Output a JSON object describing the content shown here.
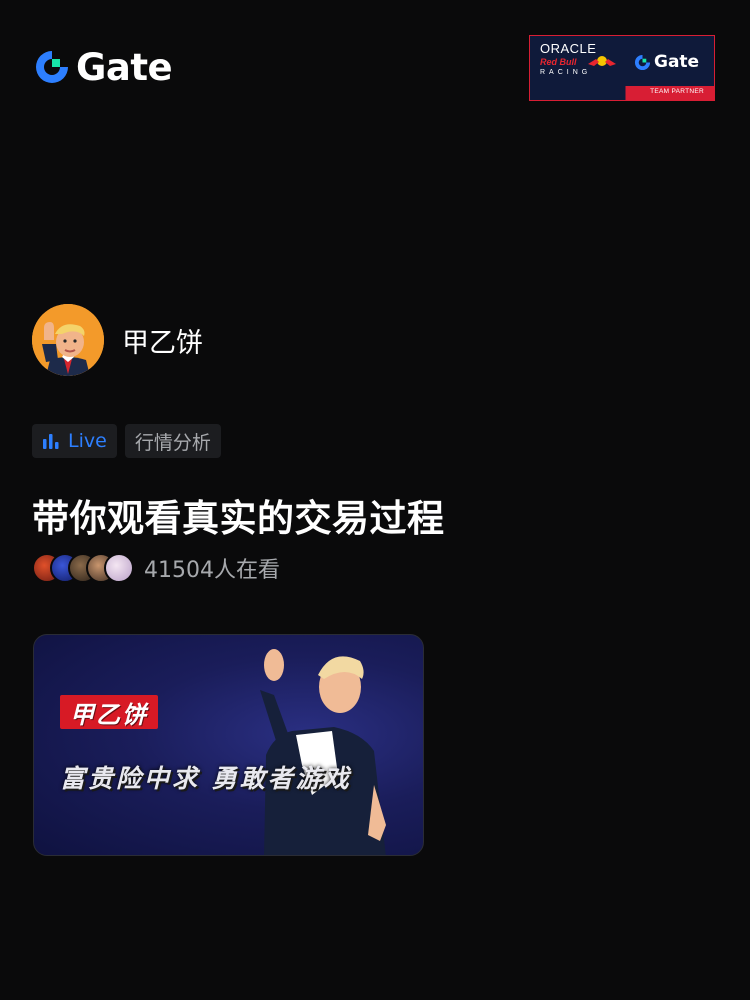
{
  "brand": {
    "name": "Gate",
    "accent": "#2d7fff",
    "green": "#17e5a8"
  },
  "partner": {
    "oracle": "ORACLE",
    "redbull": "Red Bull",
    "racing": "RACING",
    "gate": "Gate",
    "strip": "TEAM PARTNER"
  },
  "host": {
    "name": "甲乙饼",
    "avatar_icon": "host-avatar"
  },
  "tags": {
    "live_label": "Live",
    "category_label": "行情分析",
    "live_icon": "bar-chart-icon"
  },
  "stream": {
    "title": "带你观看真实的交易过程",
    "viewer_count": "41504人在看"
  },
  "thumbnail": {
    "badge": "甲乙饼",
    "slogan": "富贵险中求 勇敢者游戏"
  }
}
